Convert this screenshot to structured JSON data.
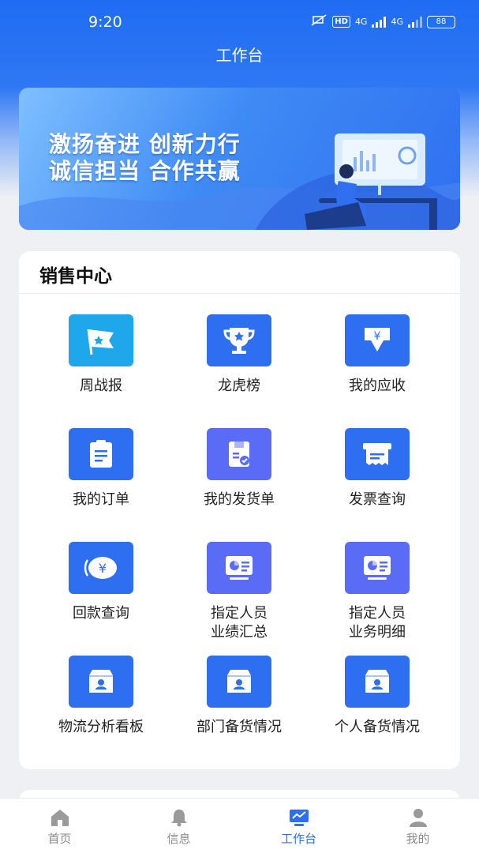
{
  "status_bar": {
    "time": "9:20",
    "hd_label": "HD",
    "net1": "4G",
    "net2": "4G",
    "battery": "88"
  },
  "header": {
    "title": "工作台"
  },
  "banner": {
    "line1": "激扬奋进  创新力行",
    "line2": "诚信担当  合作共赢"
  },
  "sales_center": {
    "title": "销售中心",
    "items": [
      {
        "label": "周战报",
        "icon": "flag-icon",
        "color": "#1ea7ea"
      },
      {
        "label": "龙虎榜",
        "icon": "trophy-icon",
        "color": "#2d6ff0"
      },
      {
        "label": "我的应收",
        "icon": "receivable-icon",
        "color": "#2d6ff0"
      },
      {
        "label": "我的订单",
        "icon": "clipboard-icon",
        "color": "#2d6ff0"
      },
      {
        "label": "我的发货单",
        "icon": "shipping-box-icon",
        "color": "#5a6cf5"
      },
      {
        "label": "发票查询",
        "icon": "invoice-icon",
        "color": "#2d6ff0"
      },
      {
        "label": "回款查询",
        "icon": "yen-coin-icon",
        "color": "#2d6ff0"
      },
      {
        "label": "指定人员\n业绩汇总",
        "icon": "dashboard-screen-icon",
        "color": "#5a6cf5"
      },
      {
        "label": "指定人员\n业务明细",
        "icon": "dashboard-screen-icon",
        "color": "#5a6cf5"
      },
      {
        "label": "物流分析看板",
        "icon": "person-box-icon",
        "color": "#2d6ff0"
      },
      {
        "label": "部门备货情况",
        "icon": "person-box-icon",
        "color": "#2d6ff0"
      },
      {
        "label": "个人备货情况",
        "icon": "person-box-icon",
        "color": "#2d6ff0"
      }
    ]
  },
  "tab_bar": {
    "tabs": [
      {
        "label": "首页",
        "icon": "home-icon"
      },
      {
        "label": "信息",
        "icon": "bell-icon"
      },
      {
        "label": "工作台",
        "icon": "monitor-chart-icon",
        "active": true
      },
      {
        "label": "我的",
        "icon": "user-icon"
      }
    ]
  },
  "colors": {
    "primary": "#2d6ff0",
    "inactive": "#8a8a8a"
  }
}
